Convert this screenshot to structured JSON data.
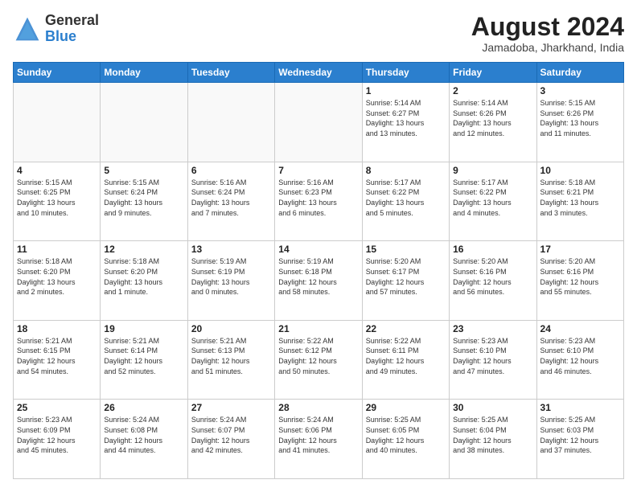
{
  "header": {
    "logo_general": "General",
    "logo_blue": "Blue",
    "month_year": "August 2024",
    "location": "Jamadoba, Jharkhand, India"
  },
  "days_of_week": [
    "Sunday",
    "Monday",
    "Tuesday",
    "Wednesday",
    "Thursday",
    "Friday",
    "Saturday"
  ],
  "weeks": [
    [
      {
        "day": "",
        "info": ""
      },
      {
        "day": "",
        "info": ""
      },
      {
        "day": "",
        "info": ""
      },
      {
        "day": "",
        "info": ""
      },
      {
        "day": "1",
        "info": "Sunrise: 5:14 AM\nSunset: 6:27 PM\nDaylight: 13 hours\nand 13 minutes."
      },
      {
        "day": "2",
        "info": "Sunrise: 5:14 AM\nSunset: 6:26 PM\nDaylight: 13 hours\nand 12 minutes."
      },
      {
        "day": "3",
        "info": "Sunrise: 5:15 AM\nSunset: 6:26 PM\nDaylight: 13 hours\nand 11 minutes."
      }
    ],
    [
      {
        "day": "4",
        "info": "Sunrise: 5:15 AM\nSunset: 6:25 PM\nDaylight: 13 hours\nand 10 minutes."
      },
      {
        "day": "5",
        "info": "Sunrise: 5:15 AM\nSunset: 6:24 PM\nDaylight: 13 hours\nand 9 minutes."
      },
      {
        "day": "6",
        "info": "Sunrise: 5:16 AM\nSunset: 6:24 PM\nDaylight: 13 hours\nand 7 minutes."
      },
      {
        "day": "7",
        "info": "Sunrise: 5:16 AM\nSunset: 6:23 PM\nDaylight: 13 hours\nand 6 minutes."
      },
      {
        "day": "8",
        "info": "Sunrise: 5:17 AM\nSunset: 6:22 PM\nDaylight: 13 hours\nand 5 minutes."
      },
      {
        "day": "9",
        "info": "Sunrise: 5:17 AM\nSunset: 6:22 PM\nDaylight: 13 hours\nand 4 minutes."
      },
      {
        "day": "10",
        "info": "Sunrise: 5:18 AM\nSunset: 6:21 PM\nDaylight: 13 hours\nand 3 minutes."
      }
    ],
    [
      {
        "day": "11",
        "info": "Sunrise: 5:18 AM\nSunset: 6:20 PM\nDaylight: 13 hours\nand 2 minutes."
      },
      {
        "day": "12",
        "info": "Sunrise: 5:18 AM\nSunset: 6:20 PM\nDaylight: 13 hours\nand 1 minute."
      },
      {
        "day": "13",
        "info": "Sunrise: 5:19 AM\nSunset: 6:19 PM\nDaylight: 13 hours\nand 0 minutes."
      },
      {
        "day": "14",
        "info": "Sunrise: 5:19 AM\nSunset: 6:18 PM\nDaylight: 12 hours\nand 58 minutes."
      },
      {
        "day": "15",
        "info": "Sunrise: 5:20 AM\nSunset: 6:17 PM\nDaylight: 12 hours\nand 57 minutes."
      },
      {
        "day": "16",
        "info": "Sunrise: 5:20 AM\nSunset: 6:16 PM\nDaylight: 12 hours\nand 56 minutes."
      },
      {
        "day": "17",
        "info": "Sunrise: 5:20 AM\nSunset: 6:16 PM\nDaylight: 12 hours\nand 55 minutes."
      }
    ],
    [
      {
        "day": "18",
        "info": "Sunrise: 5:21 AM\nSunset: 6:15 PM\nDaylight: 12 hours\nand 54 minutes."
      },
      {
        "day": "19",
        "info": "Sunrise: 5:21 AM\nSunset: 6:14 PM\nDaylight: 12 hours\nand 52 minutes."
      },
      {
        "day": "20",
        "info": "Sunrise: 5:21 AM\nSunset: 6:13 PM\nDaylight: 12 hours\nand 51 minutes."
      },
      {
        "day": "21",
        "info": "Sunrise: 5:22 AM\nSunset: 6:12 PM\nDaylight: 12 hours\nand 50 minutes."
      },
      {
        "day": "22",
        "info": "Sunrise: 5:22 AM\nSunset: 6:11 PM\nDaylight: 12 hours\nand 49 minutes."
      },
      {
        "day": "23",
        "info": "Sunrise: 5:23 AM\nSunset: 6:10 PM\nDaylight: 12 hours\nand 47 minutes."
      },
      {
        "day": "24",
        "info": "Sunrise: 5:23 AM\nSunset: 6:10 PM\nDaylight: 12 hours\nand 46 minutes."
      }
    ],
    [
      {
        "day": "25",
        "info": "Sunrise: 5:23 AM\nSunset: 6:09 PM\nDaylight: 12 hours\nand 45 minutes."
      },
      {
        "day": "26",
        "info": "Sunrise: 5:24 AM\nSunset: 6:08 PM\nDaylight: 12 hours\nand 44 minutes."
      },
      {
        "day": "27",
        "info": "Sunrise: 5:24 AM\nSunset: 6:07 PM\nDaylight: 12 hours\nand 42 minutes."
      },
      {
        "day": "28",
        "info": "Sunrise: 5:24 AM\nSunset: 6:06 PM\nDaylight: 12 hours\nand 41 minutes."
      },
      {
        "day": "29",
        "info": "Sunrise: 5:25 AM\nSunset: 6:05 PM\nDaylight: 12 hours\nand 40 minutes."
      },
      {
        "day": "30",
        "info": "Sunrise: 5:25 AM\nSunset: 6:04 PM\nDaylight: 12 hours\nand 38 minutes."
      },
      {
        "day": "31",
        "info": "Sunrise: 5:25 AM\nSunset: 6:03 PM\nDaylight: 12 hours\nand 37 minutes."
      }
    ]
  ]
}
